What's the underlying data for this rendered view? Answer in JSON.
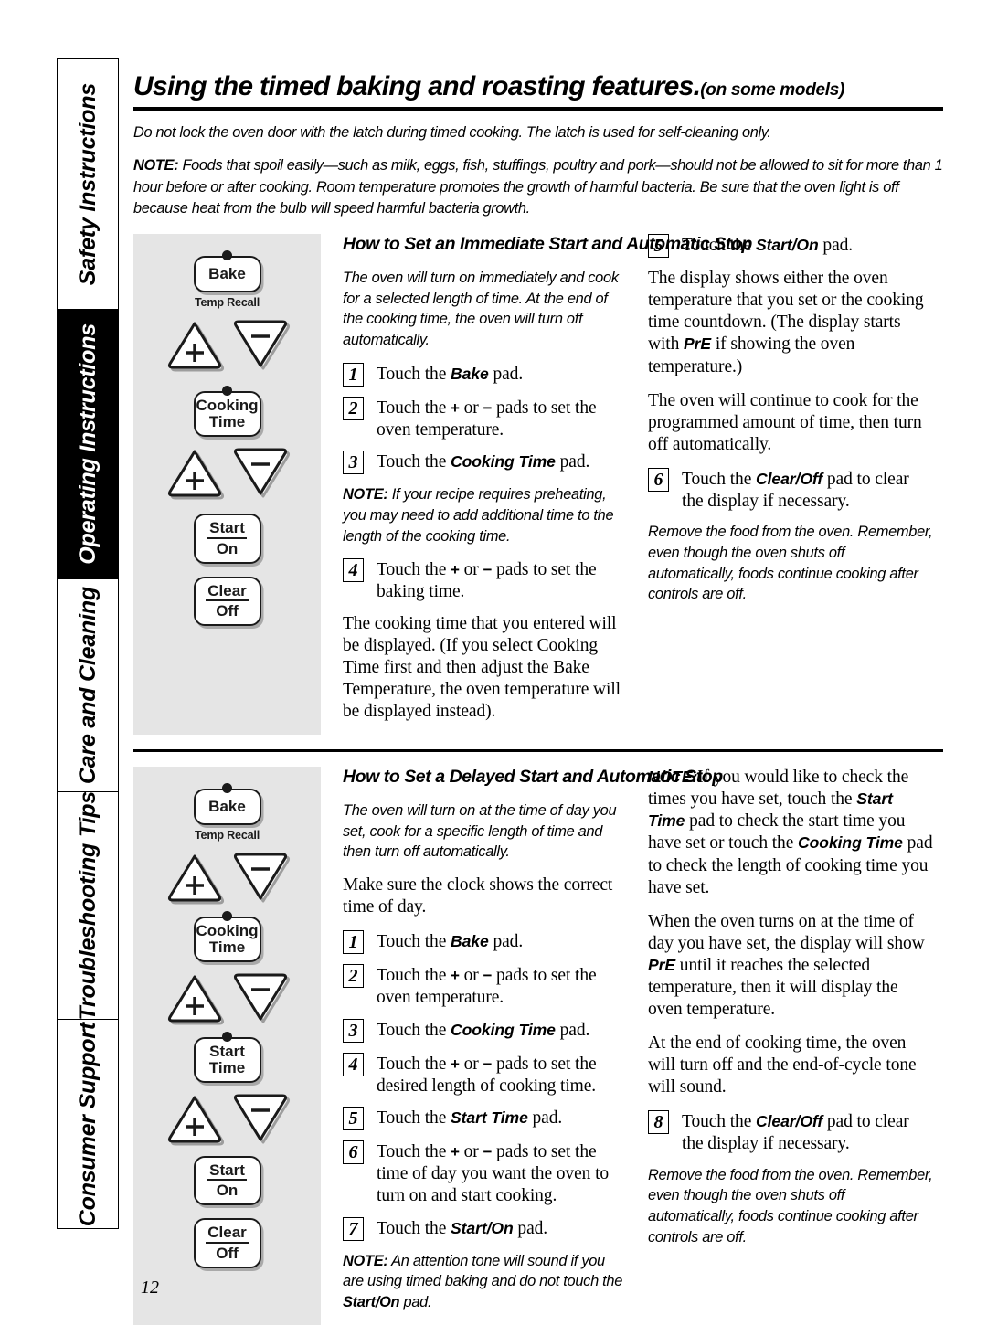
{
  "sidebar": {
    "tabs": [
      {
        "label": "Safety Instructions",
        "active": false
      },
      {
        "label": "Operating Instructions",
        "active": true
      },
      {
        "label": "Care and Cleaning",
        "active": false
      },
      {
        "label": "Troubleshooting Tips",
        "active": false
      },
      {
        "label": "Consumer Support",
        "active": false
      }
    ]
  },
  "header": {
    "title": "Using the timed baking and roasting features.",
    "subtitle": "(on some models)",
    "warning": "Do not lock the oven door with the latch during timed cooking. The latch is used for self-cleaning only.",
    "note_label": "NOTE:",
    "note_body": "Foods that spoil easily—such as milk, eggs, fish, stuffings, poultry and pork—should not be allowed to sit for more than 1 hour before or after cooking. Room temperature promotes the growth of harmful bacteria. Be sure that the oven light is off because heat from the bulb will speed harmful bacteria growth."
  },
  "control_panel_1": {
    "bake_label": "Bake",
    "temp_recall_label": "Temp Recall",
    "cooking_time_line1": "Cooking",
    "cooking_time_line2": "Time",
    "plus_symbol": "+",
    "minus_symbol": "−",
    "start_on_top": "Start",
    "start_on_bottom": "On",
    "clear_off_top": "Clear",
    "clear_off_bottom": "Off"
  },
  "control_panel_2": {
    "bake_label": "Bake",
    "temp_recall_label": "Temp Recall",
    "cooking_time_line1": "Cooking",
    "cooking_time_line2": "Time",
    "start_time_line1": "Start",
    "start_time_line2": "Time",
    "plus_symbol": "+",
    "minus_symbol": "−",
    "start_on_top": "Start",
    "start_on_bottom": "On",
    "clear_off_top": "Clear",
    "clear_off_bottom": "Off",
    "page_number": "12"
  },
  "section1": {
    "heading": "How to Set an Immediate Start and Automatic Stop",
    "intro": "The oven will turn on immediately and cook for a selected length of time. At the end of the cooking time, the oven will turn off automatically.",
    "step1_num": "1",
    "step1_pre": "Touch the ",
    "step1_bold": "Bake",
    "step1_post": " pad.",
    "step2_num": "2",
    "step2_pre": "Touch the ",
    "step2_plus": "+",
    "step2_mid": " or ",
    "step2_minus": "−",
    "step2_post": " pads to set the oven temperature.",
    "step3_num": "3",
    "step3_pre": "Touch the ",
    "step3_bold": "Cooking Time",
    "step3_post": " pad.",
    "note1_label": "NOTE:",
    "note1_body": "If your recipe requires preheating, you may need to add additional time to the length of the cooking time.",
    "step4_num": "4",
    "step4_pre": "Touch the ",
    "step4_plus": "+",
    "step4_mid": " or ",
    "step4_minus": "−",
    "step4_post": " pads to set the baking time.",
    "para_after_4": "The cooking time that you entered will be displayed. (If you select Cooking Time first and then adjust the Bake Temperature, the oven temperature will be displayed instead).",
    "step5_num": "5",
    "step5_pre": "Touch the ",
    "step5_bold": "Start/On",
    "step5_post": " pad.",
    "para_display_pre": "The display shows either the oven temperature that you set or the cooking time countdown. (The display starts with ",
    "para_display_bold": "PrE",
    "para_display_post": " if showing the oven temperature.)",
    "para_continue": "The oven will continue to cook for the programmed amount of time, then turn off automatically.",
    "step6_num": "6",
    "step6_pre": "Touch the ",
    "step6_bold": "Clear/Off",
    "step6_post": " pad to clear the display if necessary.",
    "closing_note": "Remove the food from the oven. Remember, even though the oven shuts off automatically, foods continue cooking after controls are off."
  },
  "section2": {
    "heading": "How to Set a Delayed Start and Automatic Stop",
    "intro": "The oven will turn on at the time of day you set, cook for a specific length of time and then turn off automatically.",
    "clock_para": "Make sure the clock shows the correct time of day.",
    "step1_num": "1",
    "step1_pre": "Touch the ",
    "step1_bold": "Bake",
    "step1_post": " pad.",
    "step2_num": "2",
    "step2_pre": "Touch the ",
    "step2_plus": "+",
    "step2_mid": " or ",
    "step2_minus": "−",
    "step2_post": " pads to set the oven temperature.",
    "step3_num": "3",
    "step3_pre": "Touch the ",
    "step3_bold": "Cooking Time",
    "step3_post": " pad.",
    "step4_num": "4",
    "step4_pre": "Touch the ",
    "step4_plus": "+",
    "step4_mid": " or ",
    "step4_minus": "−",
    "step4_post": " pads to set the desired length of cooking time.",
    "step5_num": "5",
    "step5_pre": "Touch the ",
    "step5_bold": "Start Time",
    "step5_post": " pad.",
    "step6_num": "6",
    "step6_pre": "Touch the ",
    "step6_plus": "+",
    "step6_mid": " or ",
    "step6_minus": "−",
    "step6_post": " pads to set the time of day you want the oven to turn on and start cooking.",
    "step7_num": "7",
    "step7_pre": "Touch the ",
    "step7_bold": "Start/On",
    "step7_post": " pad.",
    "note_attention_label": "NOTE:",
    "note_attention_body": "An attention tone will sound if you are using timed baking and do not touch the ",
    "note_attention_bold": "Start/On",
    "note_attention_end": " pad.",
    "note_check_label": "NOTE:",
    "note_check_part1": "If you would like to check the times you have set, touch the ",
    "note_check_bold1": "Start Time",
    "note_check_part2": " pad to check the start time you have set or touch the ",
    "note_check_bold2": "Cooking Time",
    "note_check_part3": " pad to check the length of cooking time you have set.",
    "para_turns_on_pre": "When the oven turns on at the time of day you have set, the display will show ",
    "para_turns_on_bold": "PrE",
    "para_turns_on_post": " until it reaches the selected temperature, then it will display the oven temperature.",
    "para_end_cycle": "At the end of cooking time, the oven will turn off and the end-of-cycle tone will sound.",
    "step8_num": "8",
    "step8_pre": "Touch the ",
    "step8_bold": "Clear/Off",
    "step8_post": " pad to clear the display if necessary.",
    "closing_note": "Remove the food from the oven. Remember, even though the oven shuts off automatically, foods continue cooking after controls are off."
  }
}
